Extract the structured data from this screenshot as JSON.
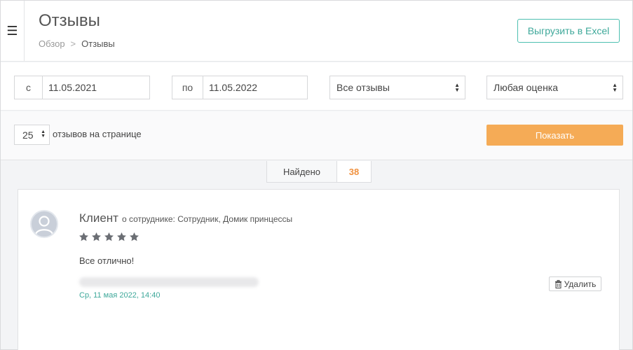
{
  "header": {
    "title": "Отзывы",
    "breadcrumb": {
      "parent": "Обзор",
      "separator": ">",
      "current": "Отзывы"
    },
    "export_label": "Выгрузить в Excel"
  },
  "filters": {
    "date_from": {
      "prefix": "с",
      "value": "11.05.2021"
    },
    "date_to": {
      "prefix": "по",
      "value": "11.05.2022"
    },
    "type_select": {
      "value": "Все отзывы"
    },
    "rating_select": {
      "value": "Любая оценка"
    }
  },
  "pagination": {
    "per_page": "25",
    "per_page_label": "отзывов на странице",
    "show_label": "Показать"
  },
  "found": {
    "label": "Найдено",
    "count": "38"
  },
  "reviews": [
    {
      "client": "Клиент",
      "about": "о сотруднике: Сотрудник, Домик принцессы",
      "rating": 5,
      "text": "Все отлично!",
      "date": "Ср, 11 мая 2022, 14:40",
      "delete_label": "Удалить"
    }
  ],
  "colors": {
    "accent_teal": "#3ea89a",
    "accent_orange": "#f5ab56",
    "count_orange": "#f0913f",
    "star": "#6b6e74"
  }
}
